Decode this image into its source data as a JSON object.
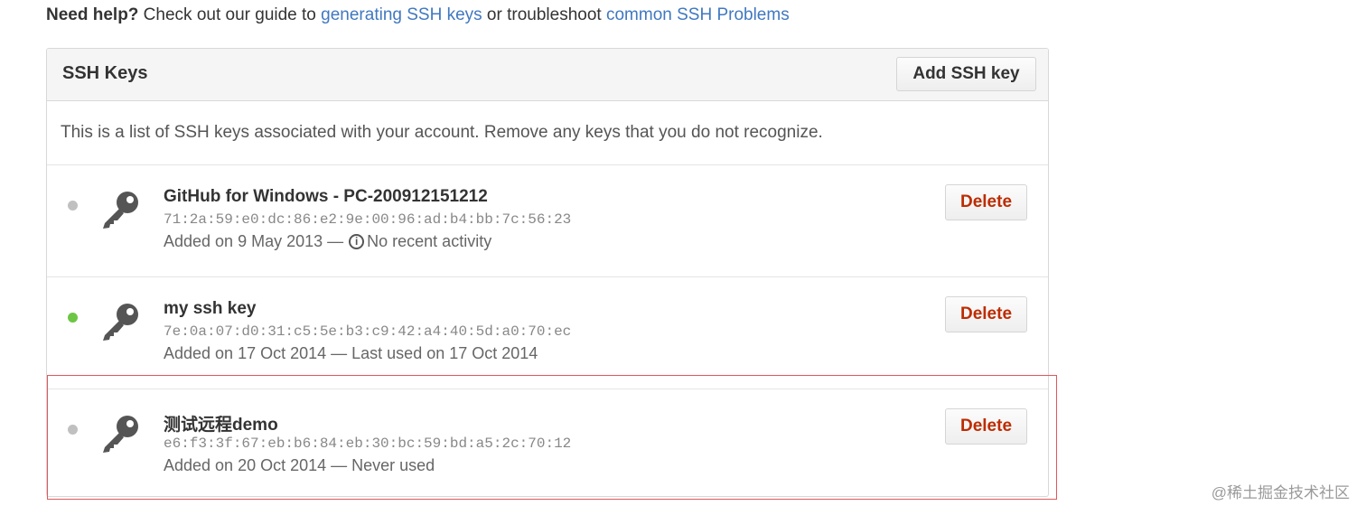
{
  "help": {
    "prefix": "Need help?",
    "text1": " Check out our guide to ",
    "link1": "generating SSH keys",
    "text2": " or troubleshoot ",
    "link2": "common SSH Problems"
  },
  "panel": {
    "title": "SSH Keys",
    "add_button": "Add SSH key",
    "intro": "This is a list of SSH keys associated with your account. Remove any keys that you do not recognize."
  },
  "keys": [
    {
      "title": "GitHub for Windows - PC-200912151212",
      "fingerprint": "71:2a:59:e0:dc:86:e2:9e:00:96:ad:b4:bb:7c:56:23",
      "added": "Added on 9 May 2013 —",
      "activity": "No recent activity",
      "delete": "Delete",
      "status": "inactive"
    },
    {
      "title": "my ssh key",
      "fingerprint": "7e:0a:07:d0:31:c5:5e:b3:c9:42:a4:40:5d:a0:70:ec",
      "added": "Added on 17 Oct 2014 — Last used on 17 Oct 2014",
      "delete": "Delete",
      "status": "active"
    },
    {
      "title": "测试远程demo",
      "fingerprint": "e6:f3:3f:67:eb:b6:84:eb:30:bc:59:bd:a5:2c:70:12",
      "added": "Added on 20 Oct 2014 — Never used",
      "delete": "Delete",
      "status": "inactive"
    }
  ],
  "watermark": "@稀土掘金技术社区",
  "colors": {
    "link": "#4078c0",
    "delete": "#bd2c00",
    "active_dot": "#6cc644",
    "inactive_dot": "#c0c0c0",
    "highlight": "#e0585c"
  },
  "icons": [
    "key-icon",
    "info-icon"
  ]
}
